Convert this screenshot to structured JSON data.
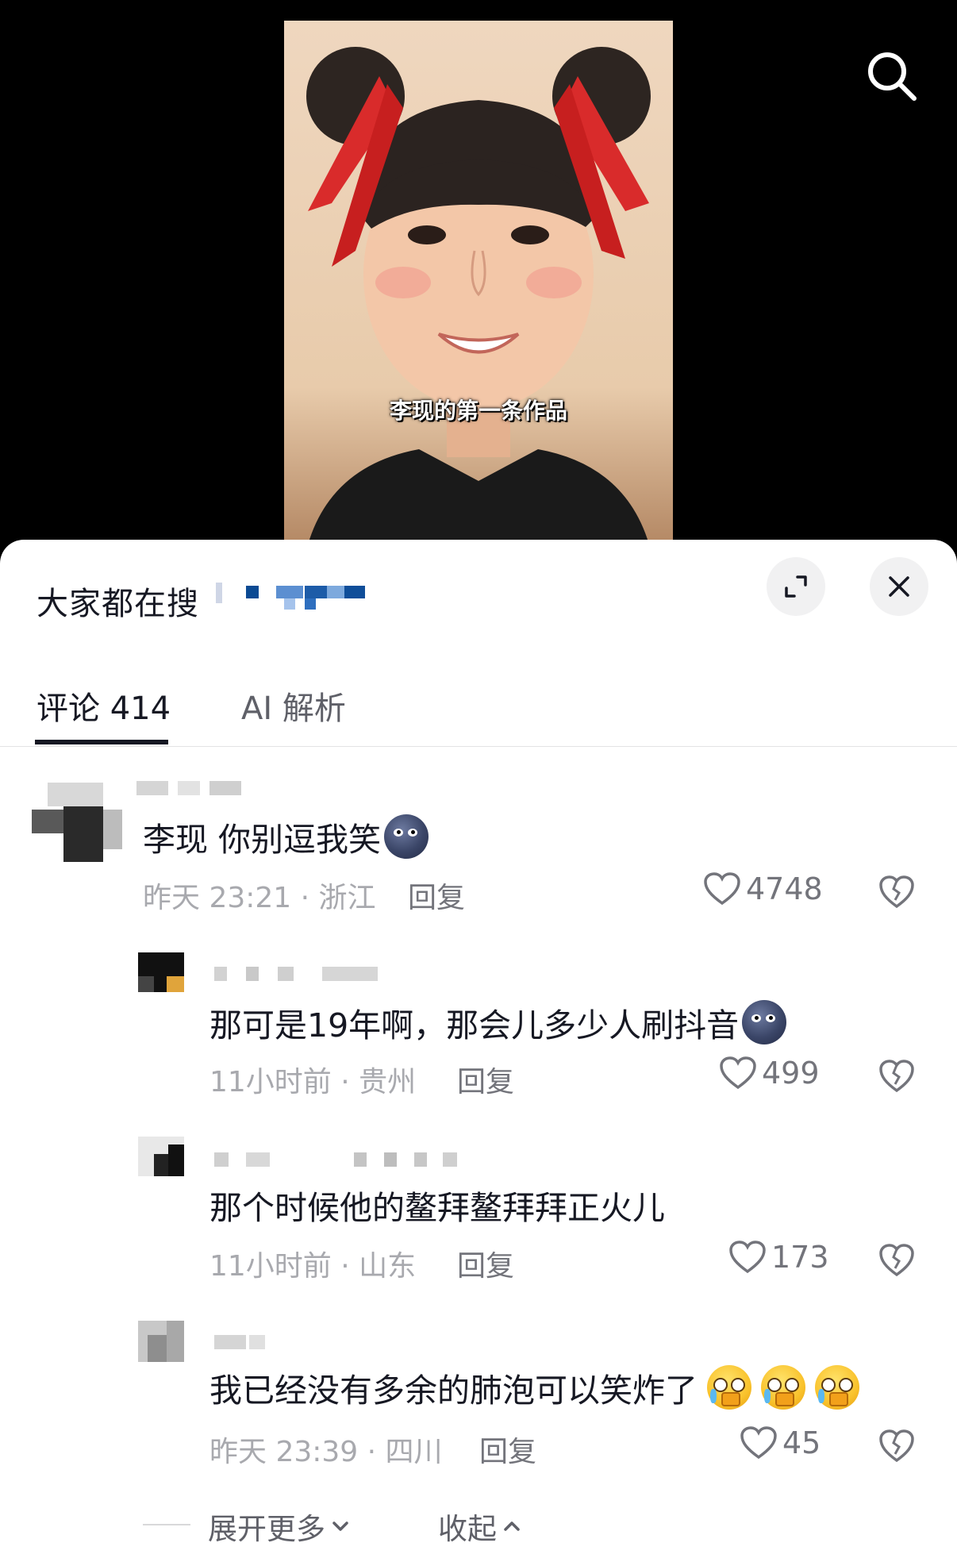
{
  "video": {
    "caption": "李现的第一条作品"
  },
  "panel": {
    "search_hint": "大家都在搜",
    "tabs": [
      {
        "label": "评论 414",
        "active": true
      },
      {
        "label": "AI 解析",
        "active": false
      }
    ]
  },
  "comments": [
    {
      "text": "李现 你别逗我笑",
      "emoji": [
        "new-moon-face"
      ],
      "time_location": "昨天 23:21 · 浙江",
      "reply_label": "回复",
      "likes": "4748"
    },
    {
      "text": "那可是19年啊，那会儿多少人刷抖音",
      "emoji": [
        "new-moon-face"
      ],
      "time_location": "11小时前 · 贵州",
      "reply_label": "回复",
      "likes": "499"
    },
    {
      "text": "那个时候他的鳌拜鳌拜拜正火儿",
      "emoji": [],
      "time_location": "11小时前 · 山东",
      "reply_label": "回复",
      "likes": "173"
    },
    {
      "text": "我已经没有多余的肺泡可以笑炸了",
      "emoji": [
        "crying-face",
        "crying-face",
        "crying-face"
      ],
      "time_location": "昨天 23:39 · 四川",
      "reply_label": "回复",
      "likes": "45"
    }
  ],
  "footer": {
    "expand_label": "展开更多",
    "collapse_label": "收起"
  }
}
